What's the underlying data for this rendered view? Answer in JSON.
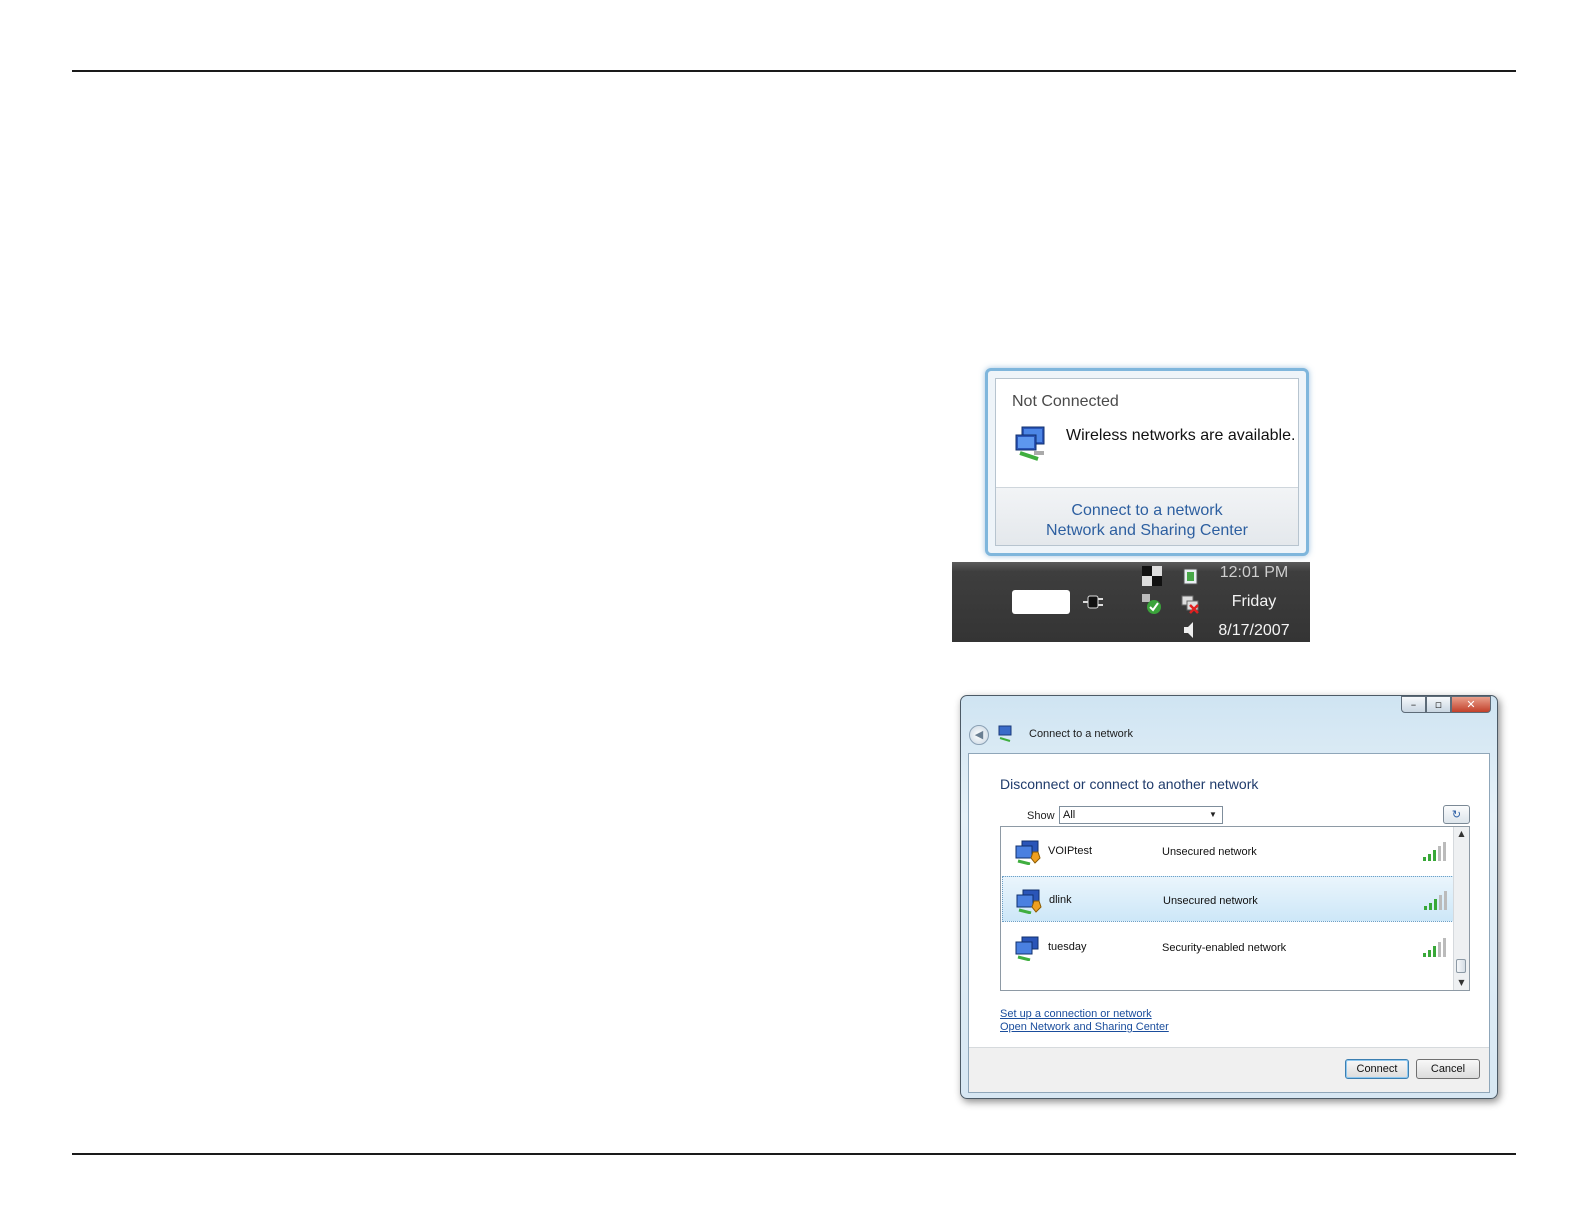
{
  "balloon": {
    "title": "Not Connected",
    "message": "Wireless networks are available.",
    "links": [
      "Connect to a network",
      "Network and Sharing Center"
    ]
  },
  "taskbar": {
    "time": "12:01 PM",
    "day": "Friday",
    "date": "8/17/2007"
  },
  "dialog": {
    "title": "Connect to a network",
    "heading": "Disconnect or connect to another network",
    "show_label": "Show",
    "show_value": "All",
    "networks": [
      {
        "name": "VOIPtest",
        "type": "Unsecured network",
        "selected": false
      },
      {
        "name": "dlink",
        "type": "Unsecured network",
        "selected": true
      },
      {
        "name": "tuesday",
        "type": "Security-enabled network",
        "selected": false
      }
    ],
    "links": [
      "Set up a connection or network",
      "Open Network and Sharing Center"
    ],
    "buttons": {
      "connect": "Connect",
      "cancel": "Cancel"
    }
  },
  "colors": {
    "accent": "#2d5fa0",
    "selected_row": "#cde7f8",
    "taskbar": "#343434"
  }
}
